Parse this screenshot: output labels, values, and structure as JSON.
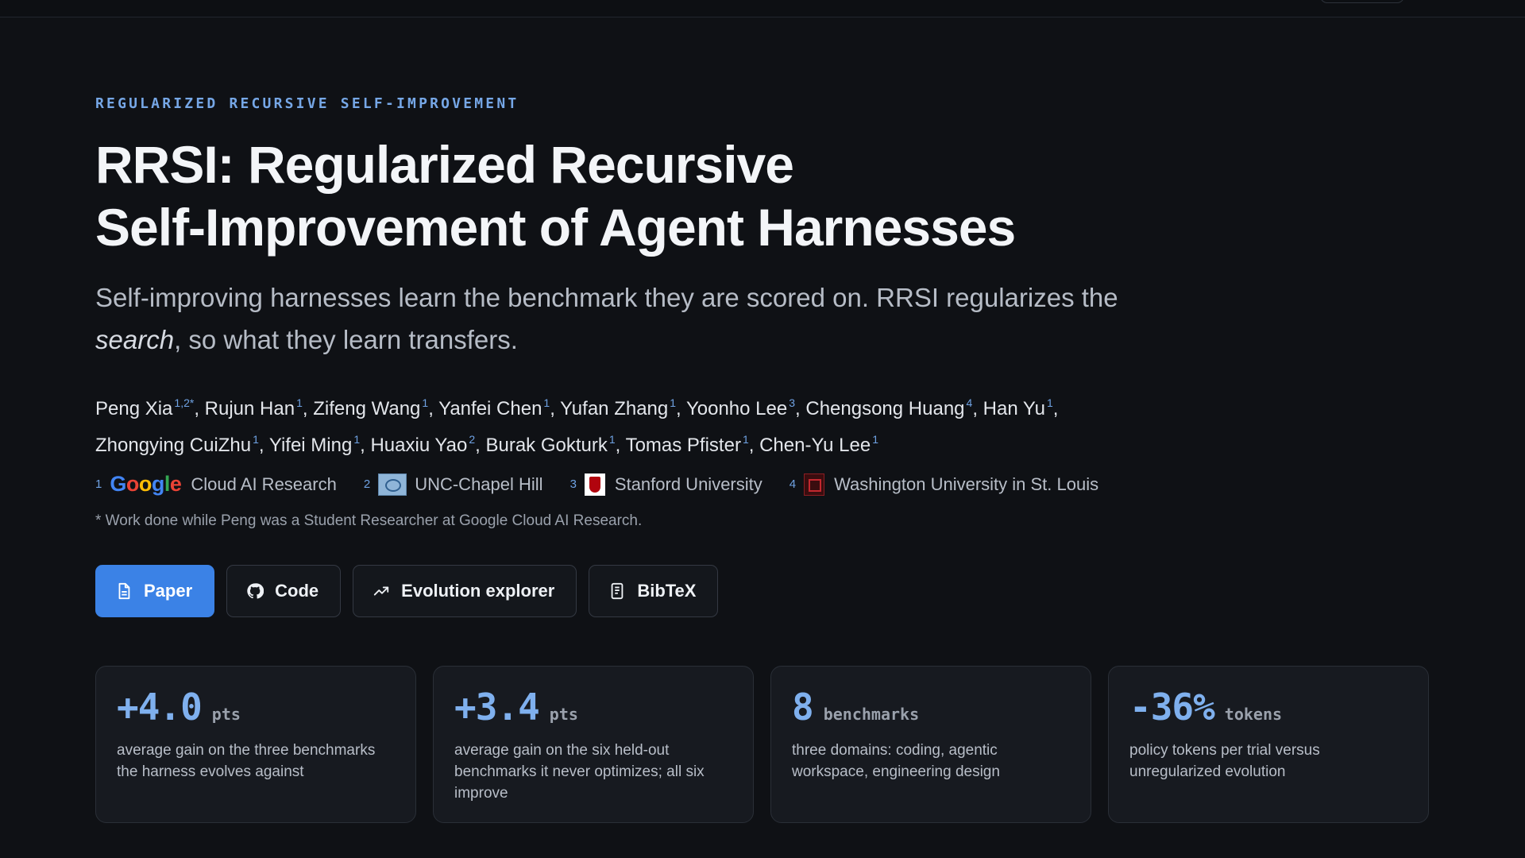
{
  "hero": {
    "eyebrow": "REGULARIZED RECURSIVE SELF-IMPROVEMENT",
    "title_line1": "RRSI: Regularized Recursive",
    "title_line2": "Self-Improvement of Agent Harnesses",
    "subtitle_part1": "Self-improving harnesses learn the benchmark they are scored on. RRSI regularizes the ",
    "subtitle_em": "search",
    "subtitle_part2": ", so what they learn transfers."
  },
  "authors": [
    {
      "name": "Peng Xia",
      "aff": "1,2*"
    },
    {
      "name": "Rujun Han",
      "aff": "1"
    },
    {
      "name": "Zifeng Wang",
      "aff": "1"
    },
    {
      "name": "Yanfei Chen",
      "aff": "1"
    },
    {
      "name": "Yufan Zhang",
      "aff": "1"
    },
    {
      "name": "Yoonho Lee",
      "aff": "3"
    },
    {
      "name": "Chengsong Huang",
      "aff": "4"
    },
    {
      "name": "Han Yu",
      "aff": "1"
    },
    {
      "name": "Zhongying CuiZhu",
      "aff": "1"
    },
    {
      "name": "Yifei Ming",
      "aff": "1"
    },
    {
      "name": "Huaxiu Yao",
      "aff": "2"
    },
    {
      "name": "Burak Gokturk",
      "aff": "1"
    },
    {
      "name": "Tomas Pfister",
      "aff": "1"
    },
    {
      "name": "Chen-Yu Lee",
      "aff": "1"
    }
  ],
  "affiliations": [
    {
      "num": "1",
      "logo_text": "Google",
      "name": "Cloud AI Research",
      "icon": "google-logo"
    },
    {
      "num": "2",
      "name": "UNC-Chapel Hill",
      "icon": "unc-logo"
    },
    {
      "num": "3",
      "name": "Stanford University",
      "icon": "stanford-logo"
    },
    {
      "num": "4",
      "name": "Washington University in St. Louis",
      "icon": "washu-logo"
    }
  ],
  "footnote": "* Work done while Peng was a Student Researcher at Google Cloud AI Research.",
  "actions": [
    {
      "label": "Paper",
      "icon": "document-icon",
      "primary": true
    },
    {
      "label": "Code",
      "icon": "github-icon",
      "primary": false
    },
    {
      "label": "Evolution explorer",
      "icon": "trend-icon",
      "primary": false
    },
    {
      "label": "BibTeX",
      "icon": "bibtex-icon",
      "primary": false
    }
  ],
  "stats": [
    {
      "value": "+4.0",
      "unit": "pts",
      "desc": "average gain on the three benchmarks the harness evolves against"
    },
    {
      "value": "+3.4",
      "unit": "pts",
      "desc": "average gain on the six held-out benchmarks it never optimizes; all six improve"
    },
    {
      "value": "8",
      "unit": "benchmarks",
      "desc": "three domains: coding, agentic workspace, engineering design"
    },
    {
      "value": "-36%",
      "unit": "tokens",
      "desc": "policy tokens per trial versus unregularized evolution"
    }
  ],
  "colors": {
    "background": "#0f1115",
    "accent": "#3b82e6",
    "stat_value": "#7fb0ee",
    "superscript": "#6fa2e3"
  }
}
